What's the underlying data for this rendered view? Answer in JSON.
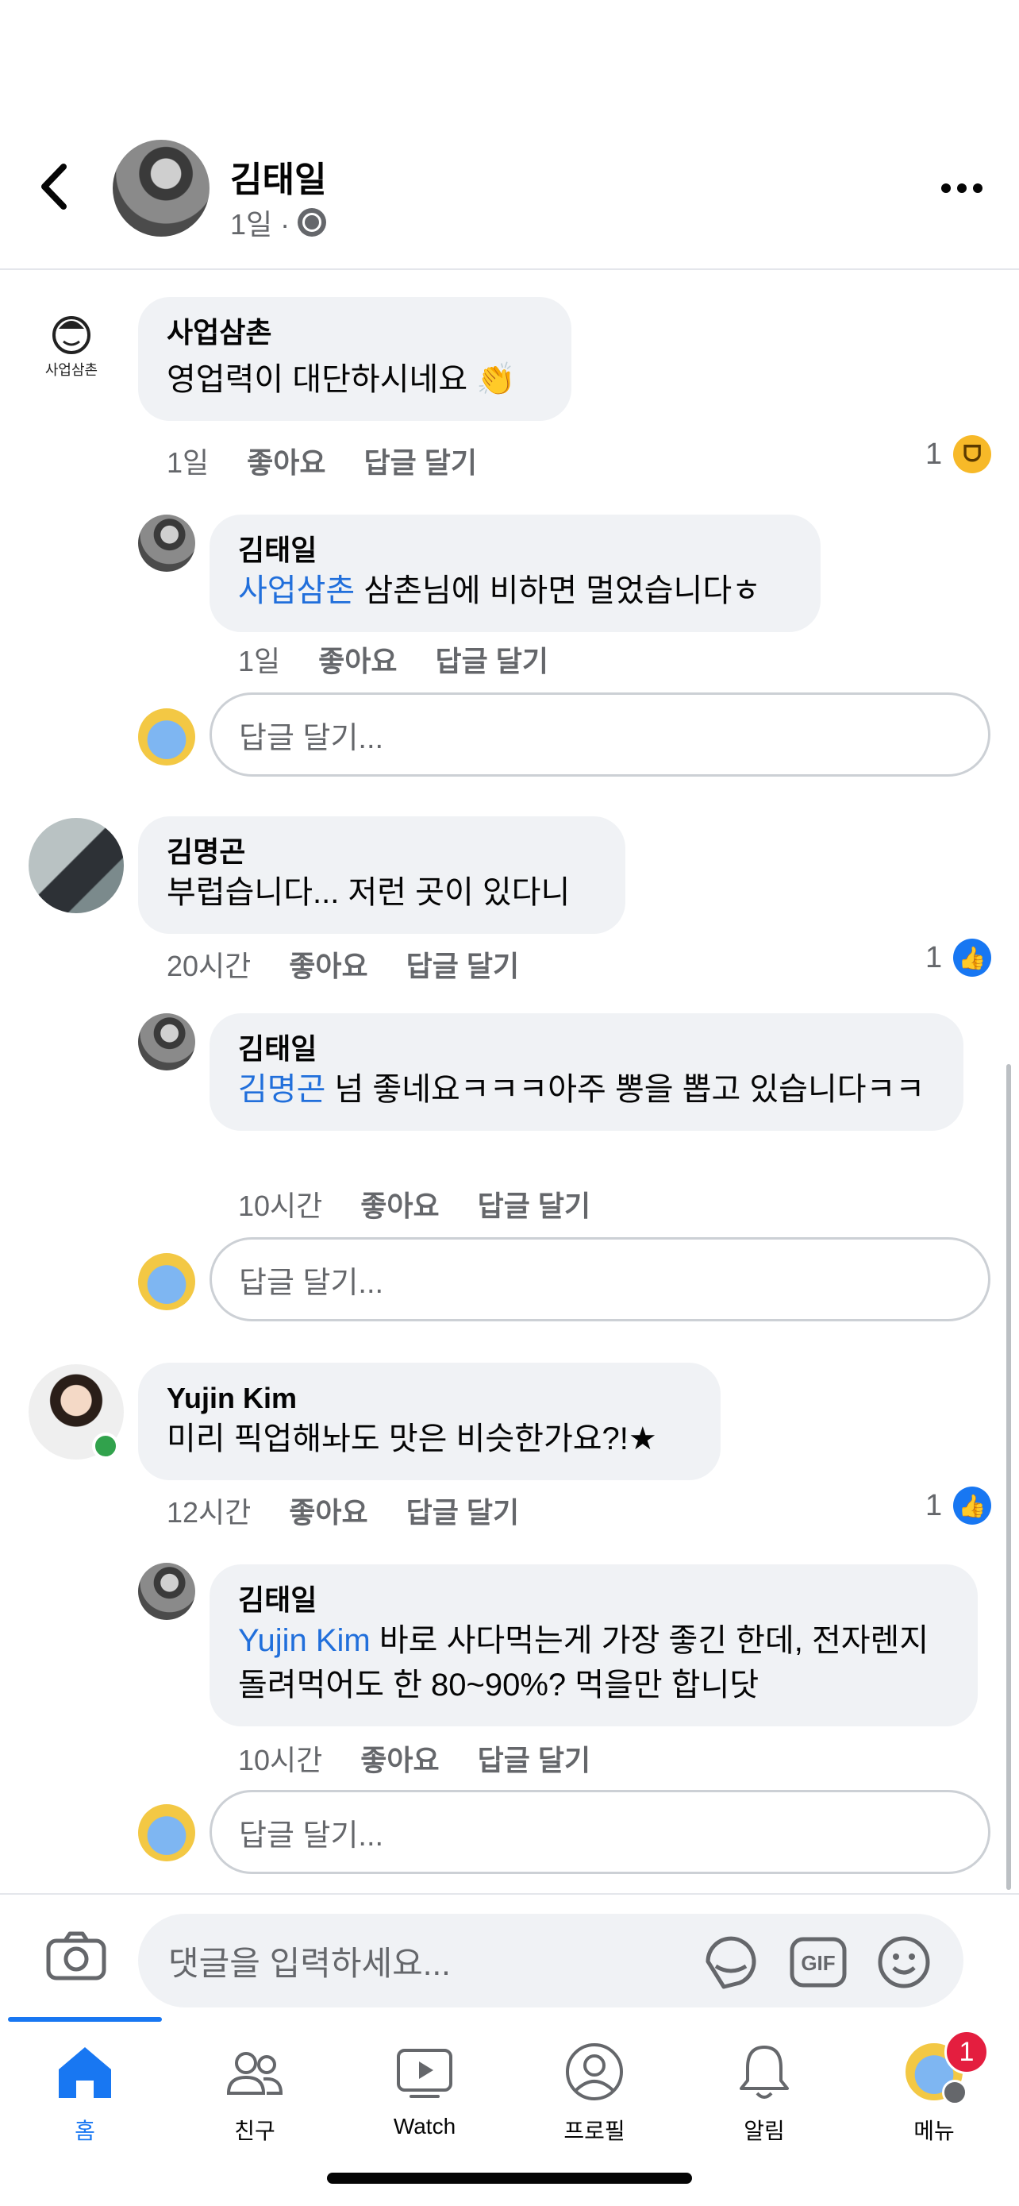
{
  "header": {
    "name": "김태일",
    "time": "1일 ·"
  },
  "comments": [
    {
      "author": "사업삼촌",
      "text": "영업력이 대단하시네요 👏",
      "time": "1일",
      "like_label": "좋아요",
      "reply_label": "답글 달기",
      "reaction_count": "1",
      "reaction_icon": "haha-icon",
      "reply": {
        "author": "김태일",
        "mention": "사업삼촌",
        "text": " 삼촌님에 비하면 멀었습니다ㅎ",
        "time": "1일",
        "like_label": "좋아요",
        "reply_label": "답글 달기"
      },
      "reply_placeholder": "답글 달기..."
    },
    {
      "author": "김명곤",
      "text": "부럽습니다... 저런 곳이 있다니",
      "time": "20시간",
      "like_label": "좋아요",
      "reply_label": "답글 달기",
      "reaction_count": "1",
      "reaction_icon": "like-icon",
      "reply": {
        "author": "김태일",
        "mention": "김명곤",
        "text": " 넘 좋네요ㅋㅋㅋ아주 뽕을 뽑고 있습니다ㅋㅋ",
        "time": "10시간",
        "like_label": "좋아요",
        "reply_label": "답글 달기"
      },
      "reply_placeholder": "답글 달기..."
    },
    {
      "author": "Yujin Kim",
      "text": "미리 픽업해놔도 맛은 비슷한가요?!★",
      "time": "12시간",
      "like_label": "좋아요",
      "reply_label": "답글 달기",
      "reaction_count": "1",
      "reaction_icon": "like-icon",
      "reply": {
        "author": "김태일",
        "mention": "Yujin Kim",
        "text": " 바로 사다먹는게 가장 좋긴 한데, 전자렌지 돌려먹어도 한 80~90%? 먹을만 합니닷",
        "time": "10시간",
        "like_label": "좋아요",
        "reply_label": "답글 달기"
      },
      "reply_placeholder": "답글 달기..."
    }
  ],
  "composer": {
    "placeholder": "댓글을 입력하세요..."
  },
  "nav": {
    "items": [
      {
        "label": "홈",
        "icon": "home-icon"
      },
      {
        "label": "친구",
        "icon": "friends-icon"
      },
      {
        "label": "Watch",
        "icon": "watch-icon"
      },
      {
        "label": "프로필",
        "icon": "profile-icon"
      },
      {
        "label": "알림",
        "icon": "bell-icon"
      },
      {
        "label": "메뉴",
        "icon": "menu-avatar-icon"
      }
    ],
    "badge": "1"
  },
  "colors": {
    "accent": "#1877f2",
    "mention": "#216fdb",
    "bubble": "#f0f2f5",
    "badge": "#e41e3f"
  }
}
